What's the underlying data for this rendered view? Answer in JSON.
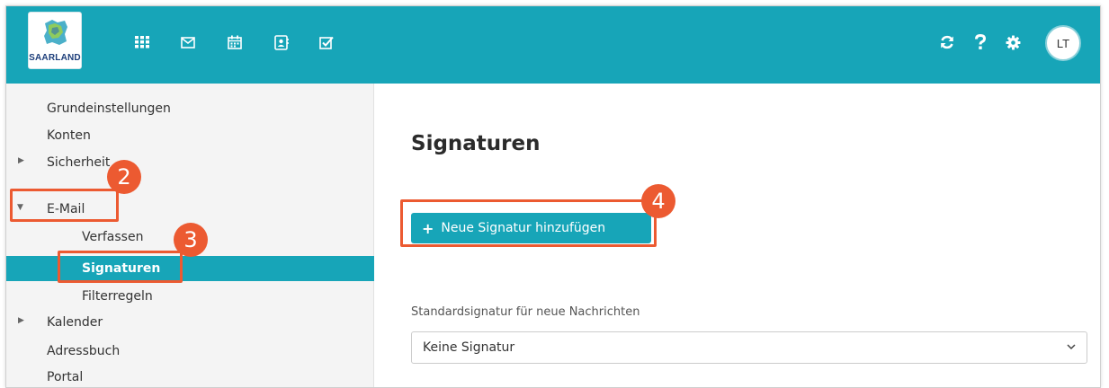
{
  "app": {
    "logo_text": "SAARLAND",
    "avatar_initials": "LT",
    "brand_color": "#17a5b8",
    "callout_color": "#ec5a31"
  },
  "topbar": {
    "left_icons": [
      "apps-grid-icon",
      "mail-icon",
      "calendar-icon",
      "contacts-icon",
      "tasks-icon"
    ],
    "right_icons": [
      "refresh-icon",
      "help-icon",
      "settings-gear-icon"
    ]
  },
  "sidebar": {
    "items": [
      {
        "label": "Grundeinstellungen"
      },
      {
        "label": "Konten"
      },
      {
        "label": "Sicherheit"
      },
      {
        "label": "E-Mail"
      },
      {
        "label": "Verfassen"
      },
      {
        "label": "Signaturen"
      },
      {
        "label": "Filterregeln"
      },
      {
        "label": "Kalender"
      },
      {
        "label": "Adressbuch"
      },
      {
        "label": "Portal"
      }
    ]
  },
  "main": {
    "title": "Signaturen",
    "add_button_label": "Neue Signatur hinzufügen",
    "default_label": "Standardsignatur für neue Nachrichten",
    "default_value": "Keine Signatur"
  },
  "callouts": [
    "2",
    "3",
    "4"
  ]
}
